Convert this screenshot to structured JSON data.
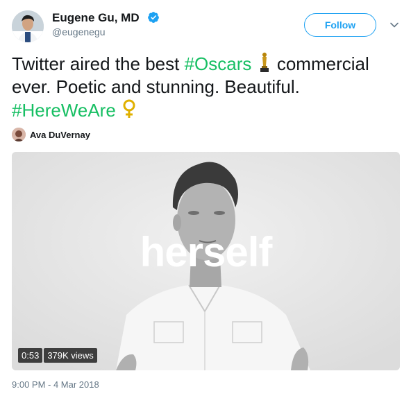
{
  "author": {
    "name": "Eugene Gu, MD",
    "handle": "@eugenegu",
    "verified": true,
    "avatar_icon": "profile-photo-doctor"
  },
  "follow_button": {
    "label": "Follow",
    "color": "#1da1f2"
  },
  "menu_icon": "chevron-down-icon",
  "tweet": {
    "line1_pre": "Twitter aired the best ",
    "hashtag_oscars": "#Oscars",
    "oscar_emoji": "oscar-trophy-icon",
    "line1_post": " commercial",
    "line2": "ever. Poetic and stunning. Beautiful.",
    "hashtag_hereweare": "#HereWeAre",
    "female_sign_emoji": "female-sign-icon",
    "hashtag_color": "#17bf63"
  },
  "via": {
    "name": "Ava DuVernay",
    "avatar_icon": "profile-photo-small"
  },
  "video": {
    "overlay_text": "herself",
    "duration": "0:53",
    "views": "379K views"
  },
  "timestamp": "9:00 PM - 4 Mar 2018"
}
